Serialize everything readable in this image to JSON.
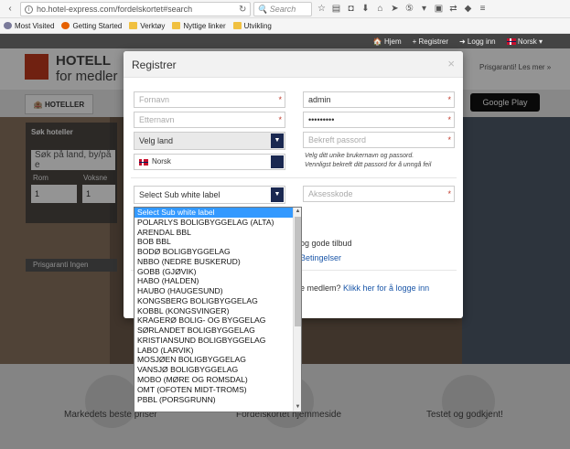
{
  "browser": {
    "url": "ho.hotel-express.com/fordelskortet#search",
    "search_placeholder": "Search",
    "bookmarks": [
      "Most Visited",
      "Getting Started",
      "Verktøy",
      "Nyttige linker",
      "Utvikling"
    ]
  },
  "site": {
    "top_links": {
      "home": "Hjem",
      "register": "Registrer",
      "login": "Logg inn",
      "language": "Norsk"
    },
    "logo_line1": "HOTELL",
    "logo_line2": "for medler",
    "header_right": "Prisgaranti! Les mer »",
    "nav_tab": "HOTELLER",
    "search_title": "Søk hoteller",
    "search_placeholder": "Søk på land, by/på e",
    "rom_label": "Rom",
    "vok_label": "Voksne",
    "rom_value": "1",
    "vok_value": "1",
    "bar_text": "Prisgaranti  Ingen",
    "features": [
      "Markedets beste priser",
      "Fordelskortet hjemmeside",
      "Testet og godkjent!"
    ],
    "appstore": "Google Play"
  },
  "modal": {
    "title": "Registrer",
    "close": "×",
    "firstname_placeholder": "Fornavn",
    "lastname_placeholder": "Etternavn",
    "username_value": "admin",
    "password_value": "•••••••••",
    "confirm_placeholder": "Bekreft passord",
    "help_line1": "Velg ditt unike brukernavn og passord.",
    "help_line2": "Vennligst bekreft ditt passord for å unngå feil",
    "country_select": "Velg land",
    "language_value": "Norsk",
    "sub_label_select": "Select Sub white label",
    "access_code_placeholder": "Aksesskode",
    "offers_text": "og gode tilbud",
    "terms_text": "Betingelser",
    "member_text": "e medlem?",
    "login_link": "Klikk her for å logge inn",
    "required_mark": "*"
  },
  "dropdown": {
    "options": [
      "Select Sub white label",
      "POLARLYS BOLIGBYGGELAG (ALTA)",
      "ARENDAL BBL",
      "BOB BBL",
      "BODØ BOLIGBYGGELAG",
      "NBBO (NEDRE BUSKERUD)",
      "GOBB (GJØVIK)",
      "HABO (HALDEN)",
      "HAUBO (HAUGESUND)",
      "KONGSBERG BOLIGBYGGELAG",
      "KOBBL (KONGSVINGER)",
      "KRAGERØ BOLIG- OG BYGGELAG",
      "SØRLANDET BOLIGBYGGELAG",
      "KRISTIANSUND BOLIGBYGGELAG",
      "LABO (LARVIK)",
      "MOSJØEN BOLIGBYGGELAG",
      "VANSJØ BOLIGBYGGELAG",
      "MOBO (MØRE OG ROMSDAL)",
      "OMT (OFOTEN MIDT-TROMS)",
      "PBBL (PORSGRUNN)"
    ],
    "selected_index": 0
  },
  "colors": {
    "accent": "#c23a1e",
    "select_arrow": "#1b2951",
    "selection": "#3399ff"
  }
}
